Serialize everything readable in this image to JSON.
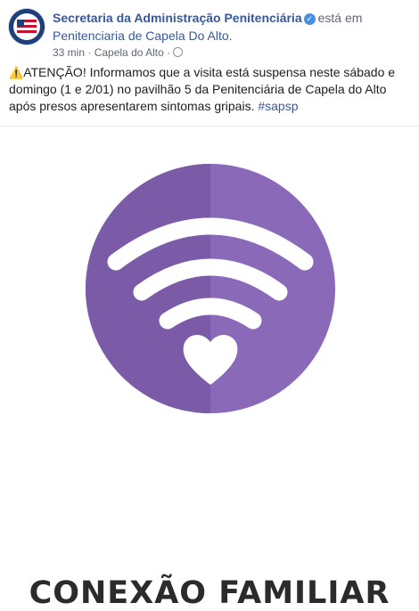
{
  "post": {
    "author": "Secretaria da Administração Penitenciária",
    "verified_icon": "verified-check-icon",
    "location_connector": "está em",
    "location": "Penitenciaria de Capela Do Alto.",
    "time": "33 min",
    "place": "Capela do Alto",
    "privacy_icon": "globe-icon",
    "warning_icon": "⚠️",
    "text": "ATENÇÃO! Informamos que a visita está suspensa neste sábado e domingo (1 e 2/01) no pavilhão 5 da Penitenciária de Capela do Alto após presos apresentarem sintomas gripais.",
    "hashtag": "#sapsp"
  },
  "image": {
    "caption": "CONEXÃO FAMILIAR",
    "circle_color_left": "#7b5aa8",
    "circle_color_right": "#8a6ab8",
    "icon": "wifi-heart-icon"
  }
}
